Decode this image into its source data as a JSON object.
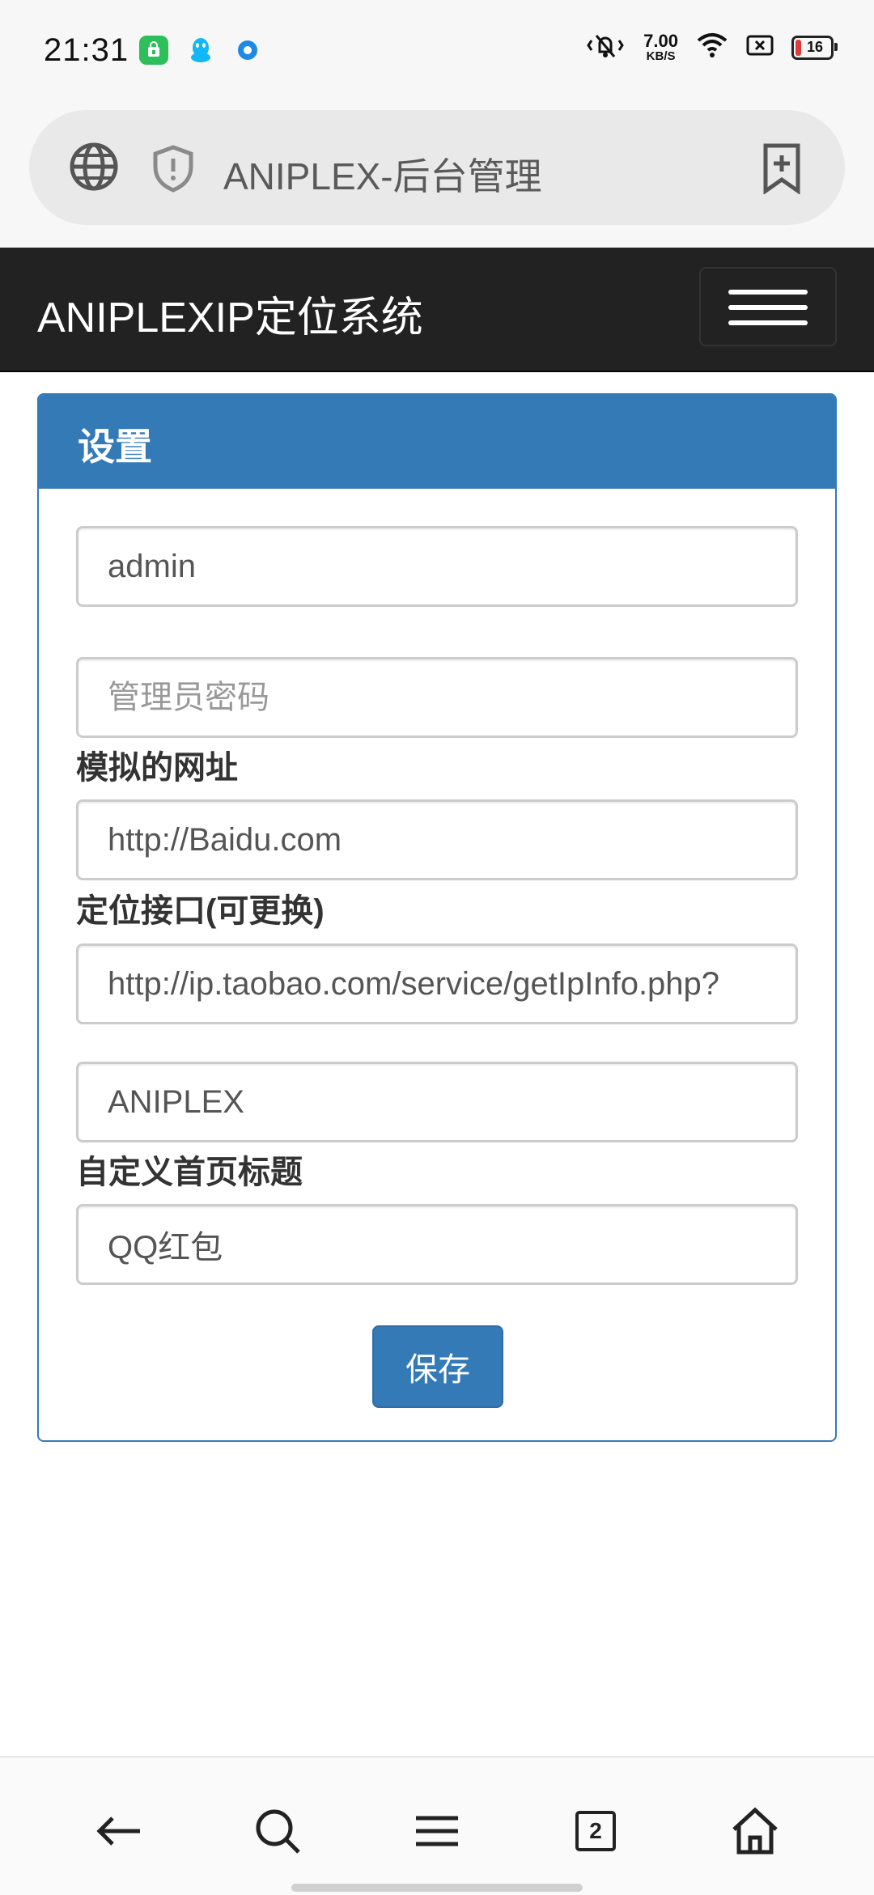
{
  "status_bar": {
    "time": "21:31",
    "app_icons": [
      "shopping-bag-icon",
      "qq-penguin-icon",
      "blue-dot-app-icon"
    ],
    "net_speed_value": "7.00",
    "net_speed_unit": "KB/S",
    "battery_level": "16",
    "icons": [
      "vibrate-silent-icon",
      "wifi-icon",
      "sim-off-icon",
      "battery-icon"
    ]
  },
  "browser": {
    "url_text": "ANIPLEX-后台管理",
    "icons": [
      "globe-icon",
      "shield-icon",
      "add-bookmark-icon"
    ]
  },
  "navbar": {
    "brand": "ANIPLEXIP定位系统",
    "toggle_icon": "hamburger-menu-icon"
  },
  "panel": {
    "title": "设置",
    "fields": {
      "username_value": "admin",
      "password_placeholder": "管理员密码",
      "mock_url_label": "模拟的网址",
      "mock_url_value": "http://Baidu.com",
      "api_label": "定位接口(可更换)",
      "api_value": "http://ip.taobao.com/service/getIpInfo.php?",
      "site_name_value": "ANIPLEX",
      "home_title_label": "自定义首页标题",
      "home_title_value": "QQ红包"
    },
    "save_label": "保存"
  },
  "bottom_nav": {
    "tabs_count": "2",
    "icons": [
      "back-arrow-icon",
      "search-icon",
      "menu-icon",
      "tabs-icon",
      "home-icon"
    ]
  },
  "colors": {
    "primary": "#337ab7",
    "navbar_bg": "#222222",
    "battery_low": "#e03b3b"
  }
}
